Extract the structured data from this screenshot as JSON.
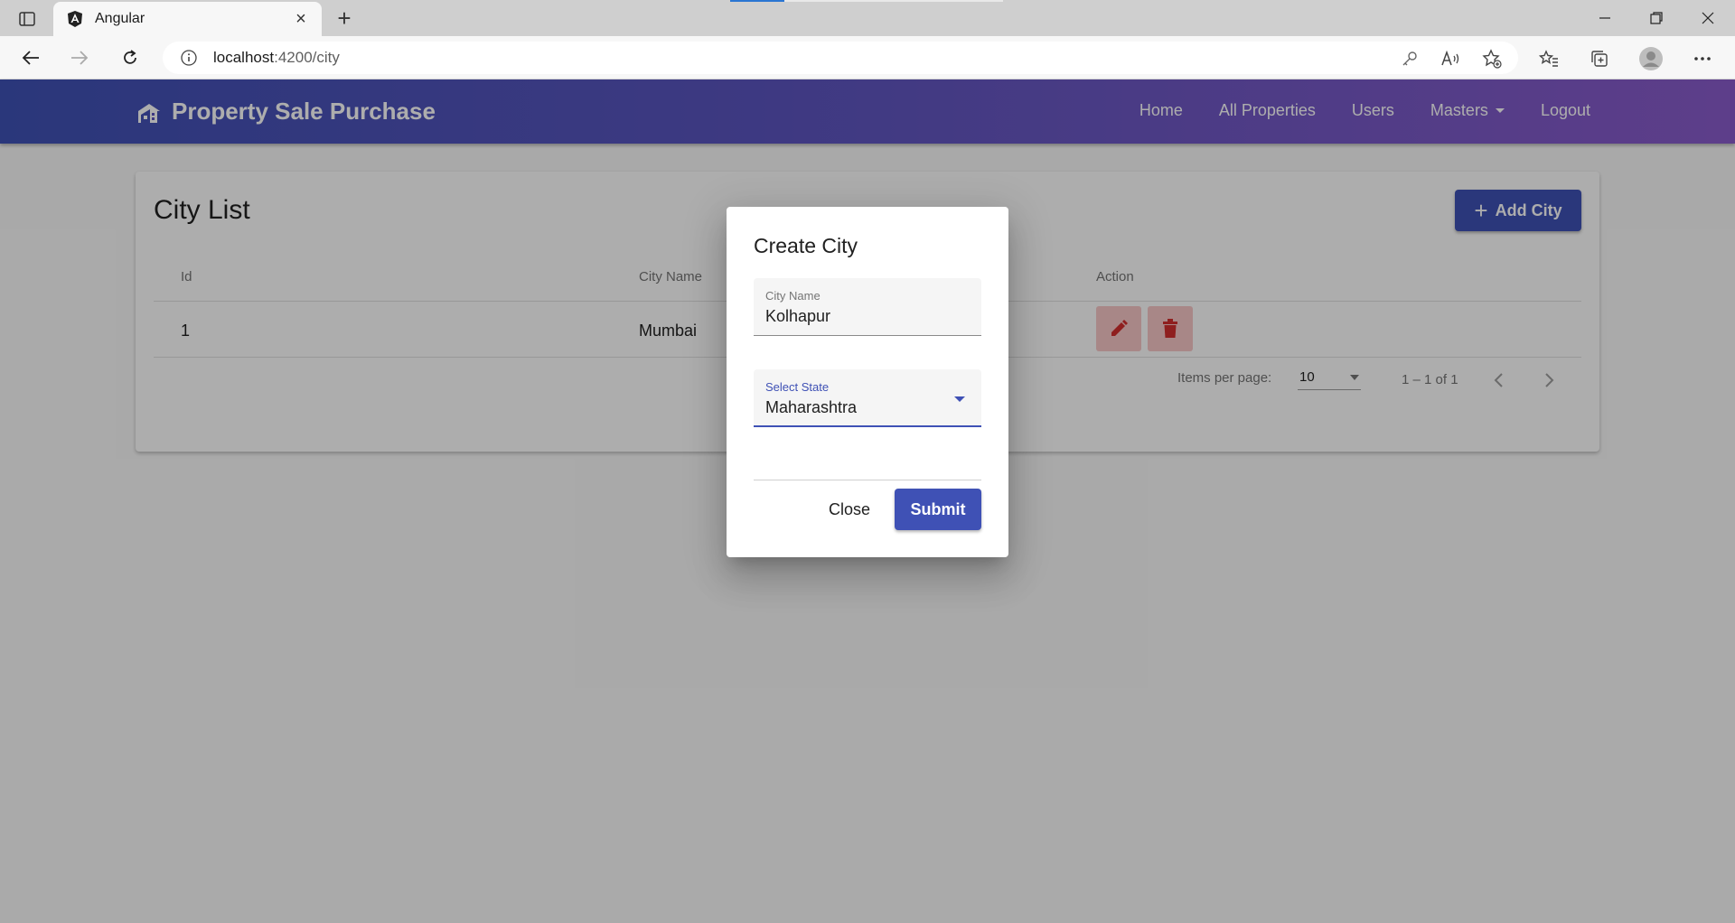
{
  "browser": {
    "tab_title": "Angular",
    "url_host": "localhost",
    "url_path": ":4200/city"
  },
  "app": {
    "brand": "Property Sale Purchase",
    "nav": {
      "home": "Home",
      "all_properties": "All Properties",
      "users": "Users",
      "masters": "Masters",
      "logout": "Logout"
    },
    "page_title": "City List",
    "add_button": "Add City",
    "table": {
      "columns": [
        "Id",
        "City Name",
        "Action"
      ],
      "rows": [
        {
          "id": "1",
          "city_name": "Mumbai"
        }
      ]
    },
    "paginator": {
      "items_per_page_label": "Items per page:",
      "page_size": "10",
      "range": "1 – 1 of 1"
    }
  },
  "dialog": {
    "title": "Create City",
    "city_name_label": "City Name",
    "city_name_value": "Kolhapur",
    "state_label": "Select State",
    "state_value": "Maharashtra",
    "close_label": "Close",
    "submit_label": "Submit"
  },
  "colors": {
    "primary": "#3f51b5",
    "gradient_end": "#8a5ccc",
    "danger": "#d32f2f"
  }
}
